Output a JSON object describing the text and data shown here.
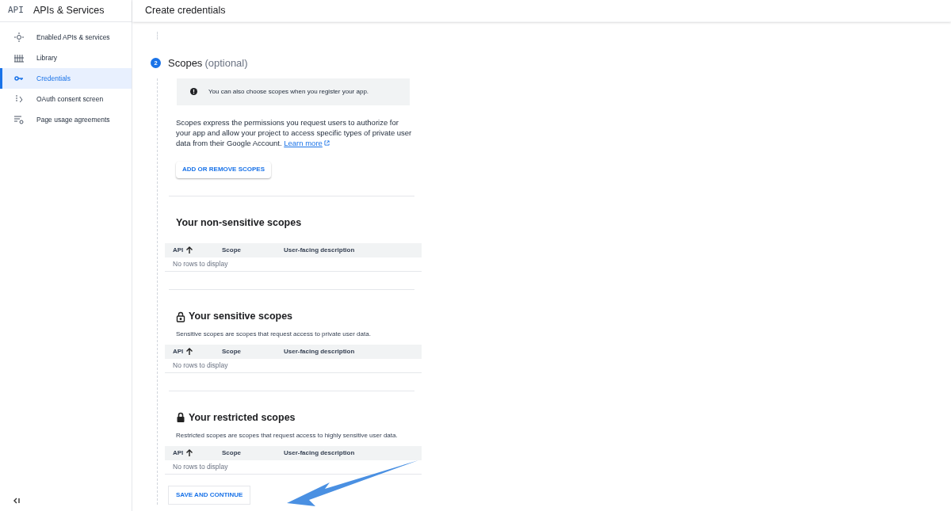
{
  "sidebar": {
    "logo": "API",
    "title": "APIs & Services",
    "items": [
      {
        "label": "Enabled APIs & services",
        "kind": "hub",
        "selected": false
      },
      {
        "label": "Library",
        "kind": "library",
        "selected": false
      },
      {
        "label": "Credentials",
        "kind": "key",
        "selected": true
      },
      {
        "label": "OAuth consent screen",
        "kind": "consent",
        "selected": false
      },
      {
        "label": "Page usage agreements",
        "kind": "settings-list",
        "selected": false
      }
    ]
  },
  "header": {
    "title": "Create credentials"
  },
  "step": {
    "number": "2",
    "title": "Scopes",
    "suffix": "(optional)",
    "info": "You can also choose scopes when you register your app.",
    "description": "Scopes express the permissions you request users to authorize for your app and allow your project to access specific types of private user data from their Google Account.",
    "link": "Learn more",
    "add_button": "ADD OR REMOVE SCOPES",
    "sections": [
      {
        "kind": "plain",
        "title": "Your non-sensitive scopes",
        "columns": [
          "API",
          "Scope",
          "User-facing description"
        ],
        "empty": "No rows to display"
      },
      {
        "kind": "sensitive",
        "title": "Your sensitive scopes",
        "description": "Sensitive scopes are scopes that request access to private user data.",
        "columns": [
          "API",
          "Scope",
          "User-facing description"
        ],
        "empty": "No rows to display"
      },
      {
        "kind": "restricted",
        "title": "Your restricted scopes",
        "description": "Restricted scopes are scopes that request access to highly sensitive user data.",
        "columns": [
          "API",
          "Scope",
          "User-facing description"
        ],
        "empty": "No rows to display"
      }
    ],
    "save_button": "SAVE AND CONTINUE"
  }
}
